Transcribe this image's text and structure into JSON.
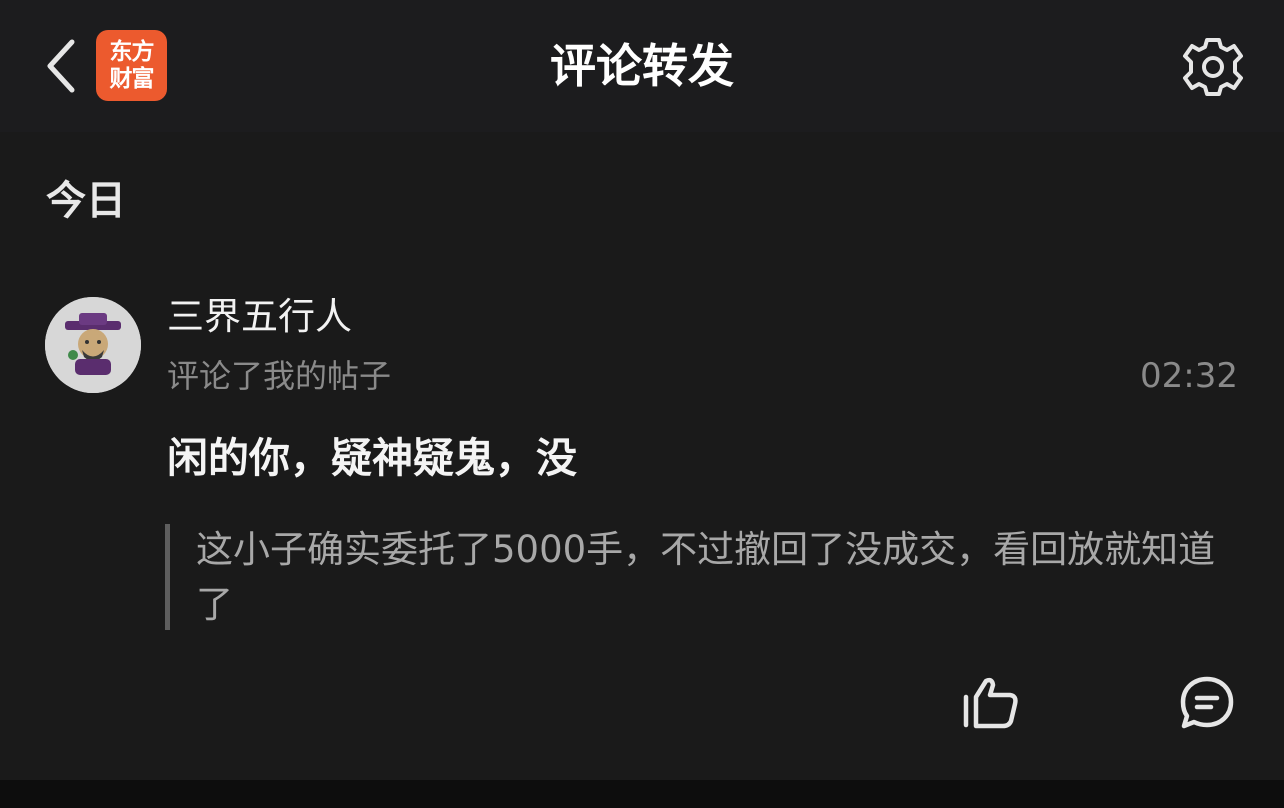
{
  "header": {
    "title": "评论转发",
    "logo_line1": "东方",
    "logo_line2": "财富",
    "logo_color": "#ec5a2e"
  },
  "section": {
    "label": "今日"
  },
  "notification": {
    "username": "三界五行人",
    "action": "评论了我的帖子",
    "time": "02:32",
    "comment": "闲的你，疑神疑鬼，没",
    "quoted_post": "这小子确实委托了5000手，不过撤回了没成交，看回放就知道了"
  },
  "icons": {
    "back": "chevron-left-icon",
    "settings": "gear-icon",
    "like": "thumbs-up-icon",
    "reply": "comment-bubble-icon"
  }
}
